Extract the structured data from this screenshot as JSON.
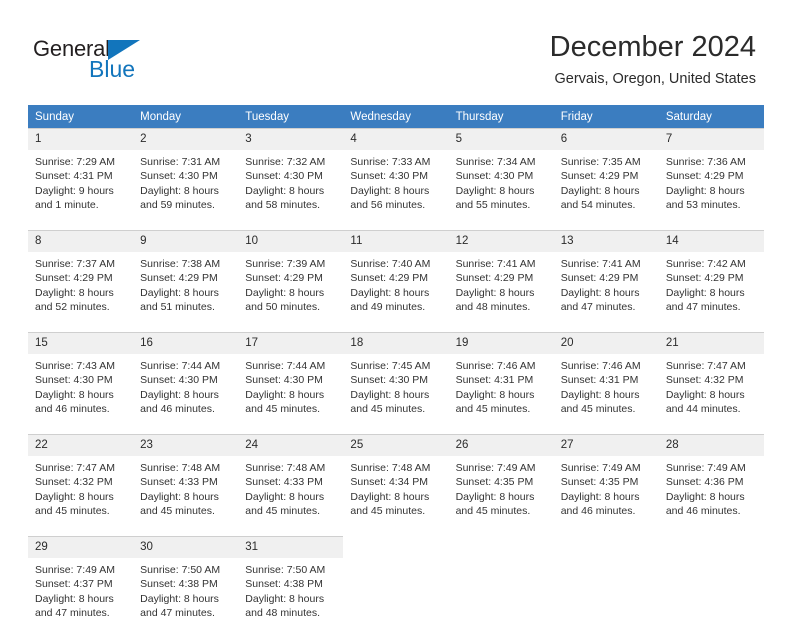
{
  "brand": {
    "name_dark": "General",
    "name_blue": "Blue",
    "accent_color": "#1275bc",
    "triangle_icon": "logo-triangle-icon"
  },
  "header": {
    "month_title": "December 2024",
    "location": "Gervais, Oregon, United States",
    "header_bg_color": "#3b7dc0",
    "daynum_bg_color": "#f0f0f0"
  },
  "weekdays": [
    "Sunday",
    "Monday",
    "Tuesday",
    "Wednesday",
    "Thursday",
    "Friday",
    "Saturday"
  ],
  "weeks": [
    [
      {
        "day": "1",
        "sunrise": "Sunrise: 7:29 AM",
        "sunset": "Sunset: 4:31 PM",
        "daylight1": "Daylight: 9 hours",
        "daylight2": "and 1 minute."
      },
      {
        "day": "2",
        "sunrise": "Sunrise: 7:31 AM",
        "sunset": "Sunset: 4:30 PM",
        "daylight1": "Daylight: 8 hours",
        "daylight2": "and 59 minutes."
      },
      {
        "day": "3",
        "sunrise": "Sunrise: 7:32 AM",
        "sunset": "Sunset: 4:30 PM",
        "daylight1": "Daylight: 8 hours",
        "daylight2": "and 58 minutes."
      },
      {
        "day": "4",
        "sunrise": "Sunrise: 7:33 AM",
        "sunset": "Sunset: 4:30 PM",
        "daylight1": "Daylight: 8 hours",
        "daylight2": "and 56 minutes."
      },
      {
        "day": "5",
        "sunrise": "Sunrise: 7:34 AM",
        "sunset": "Sunset: 4:30 PM",
        "daylight1": "Daylight: 8 hours",
        "daylight2": "and 55 minutes."
      },
      {
        "day": "6",
        "sunrise": "Sunrise: 7:35 AM",
        "sunset": "Sunset: 4:29 PM",
        "daylight1": "Daylight: 8 hours",
        "daylight2": "and 54 minutes."
      },
      {
        "day": "7",
        "sunrise": "Sunrise: 7:36 AM",
        "sunset": "Sunset: 4:29 PM",
        "daylight1": "Daylight: 8 hours",
        "daylight2": "and 53 minutes."
      }
    ],
    [
      {
        "day": "8",
        "sunrise": "Sunrise: 7:37 AM",
        "sunset": "Sunset: 4:29 PM",
        "daylight1": "Daylight: 8 hours",
        "daylight2": "and 52 minutes."
      },
      {
        "day": "9",
        "sunrise": "Sunrise: 7:38 AM",
        "sunset": "Sunset: 4:29 PM",
        "daylight1": "Daylight: 8 hours",
        "daylight2": "and 51 minutes."
      },
      {
        "day": "10",
        "sunrise": "Sunrise: 7:39 AM",
        "sunset": "Sunset: 4:29 PM",
        "daylight1": "Daylight: 8 hours",
        "daylight2": "and 50 minutes."
      },
      {
        "day": "11",
        "sunrise": "Sunrise: 7:40 AM",
        "sunset": "Sunset: 4:29 PM",
        "daylight1": "Daylight: 8 hours",
        "daylight2": "and 49 minutes."
      },
      {
        "day": "12",
        "sunrise": "Sunrise: 7:41 AM",
        "sunset": "Sunset: 4:29 PM",
        "daylight1": "Daylight: 8 hours",
        "daylight2": "and 48 minutes."
      },
      {
        "day": "13",
        "sunrise": "Sunrise: 7:41 AM",
        "sunset": "Sunset: 4:29 PM",
        "daylight1": "Daylight: 8 hours",
        "daylight2": "and 47 minutes."
      },
      {
        "day": "14",
        "sunrise": "Sunrise: 7:42 AM",
        "sunset": "Sunset: 4:29 PM",
        "daylight1": "Daylight: 8 hours",
        "daylight2": "and 47 minutes."
      }
    ],
    [
      {
        "day": "15",
        "sunrise": "Sunrise: 7:43 AM",
        "sunset": "Sunset: 4:30 PM",
        "daylight1": "Daylight: 8 hours",
        "daylight2": "and 46 minutes."
      },
      {
        "day": "16",
        "sunrise": "Sunrise: 7:44 AM",
        "sunset": "Sunset: 4:30 PM",
        "daylight1": "Daylight: 8 hours",
        "daylight2": "and 46 minutes."
      },
      {
        "day": "17",
        "sunrise": "Sunrise: 7:44 AM",
        "sunset": "Sunset: 4:30 PM",
        "daylight1": "Daylight: 8 hours",
        "daylight2": "and 45 minutes."
      },
      {
        "day": "18",
        "sunrise": "Sunrise: 7:45 AM",
        "sunset": "Sunset: 4:30 PM",
        "daylight1": "Daylight: 8 hours",
        "daylight2": "and 45 minutes."
      },
      {
        "day": "19",
        "sunrise": "Sunrise: 7:46 AM",
        "sunset": "Sunset: 4:31 PM",
        "daylight1": "Daylight: 8 hours",
        "daylight2": "and 45 minutes."
      },
      {
        "day": "20",
        "sunrise": "Sunrise: 7:46 AM",
        "sunset": "Sunset: 4:31 PM",
        "daylight1": "Daylight: 8 hours",
        "daylight2": "and 45 minutes."
      },
      {
        "day": "21",
        "sunrise": "Sunrise: 7:47 AM",
        "sunset": "Sunset: 4:32 PM",
        "daylight1": "Daylight: 8 hours",
        "daylight2": "and 44 minutes."
      }
    ],
    [
      {
        "day": "22",
        "sunrise": "Sunrise: 7:47 AM",
        "sunset": "Sunset: 4:32 PM",
        "daylight1": "Daylight: 8 hours",
        "daylight2": "and 45 minutes."
      },
      {
        "day": "23",
        "sunrise": "Sunrise: 7:48 AM",
        "sunset": "Sunset: 4:33 PM",
        "daylight1": "Daylight: 8 hours",
        "daylight2": "and 45 minutes."
      },
      {
        "day": "24",
        "sunrise": "Sunrise: 7:48 AM",
        "sunset": "Sunset: 4:33 PM",
        "daylight1": "Daylight: 8 hours",
        "daylight2": "and 45 minutes."
      },
      {
        "day": "25",
        "sunrise": "Sunrise: 7:48 AM",
        "sunset": "Sunset: 4:34 PM",
        "daylight1": "Daylight: 8 hours",
        "daylight2": "and 45 minutes."
      },
      {
        "day": "26",
        "sunrise": "Sunrise: 7:49 AM",
        "sunset": "Sunset: 4:35 PM",
        "daylight1": "Daylight: 8 hours",
        "daylight2": "and 45 minutes."
      },
      {
        "day": "27",
        "sunrise": "Sunrise: 7:49 AM",
        "sunset": "Sunset: 4:35 PM",
        "daylight1": "Daylight: 8 hours",
        "daylight2": "and 46 minutes."
      },
      {
        "day": "28",
        "sunrise": "Sunrise: 7:49 AM",
        "sunset": "Sunset: 4:36 PM",
        "daylight1": "Daylight: 8 hours",
        "daylight2": "and 46 minutes."
      }
    ],
    [
      {
        "day": "29",
        "sunrise": "Sunrise: 7:49 AM",
        "sunset": "Sunset: 4:37 PM",
        "daylight1": "Daylight: 8 hours",
        "daylight2": "and 47 minutes."
      },
      {
        "day": "30",
        "sunrise": "Sunrise: 7:50 AM",
        "sunset": "Sunset: 4:38 PM",
        "daylight1": "Daylight: 8 hours",
        "daylight2": "and 47 minutes."
      },
      {
        "day": "31",
        "sunrise": "Sunrise: 7:50 AM",
        "sunset": "Sunset: 4:38 PM",
        "daylight1": "Daylight: 8 hours",
        "daylight2": "and 48 minutes."
      },
      {
        "day": "",
        "sunrise": "",
        "sunset": "",
        "daylight1": "",
        "daylight2": ""
      },
      {
        "day": "",
        "sunrise": "",
        "sunset": "",
        "daylight1": "",
        "daylight2": ""
      },
      {
        "day": "",
        "sunrise": "",
        "sunset": "",
        "daylight1": "",
        "daylight2": ""
      },
      {
        "day": "",
        "sunrise": "",
        "sunset": "",
        "daylight1": "",
        "daylight2": ""
      }
    ]
  ]
}
